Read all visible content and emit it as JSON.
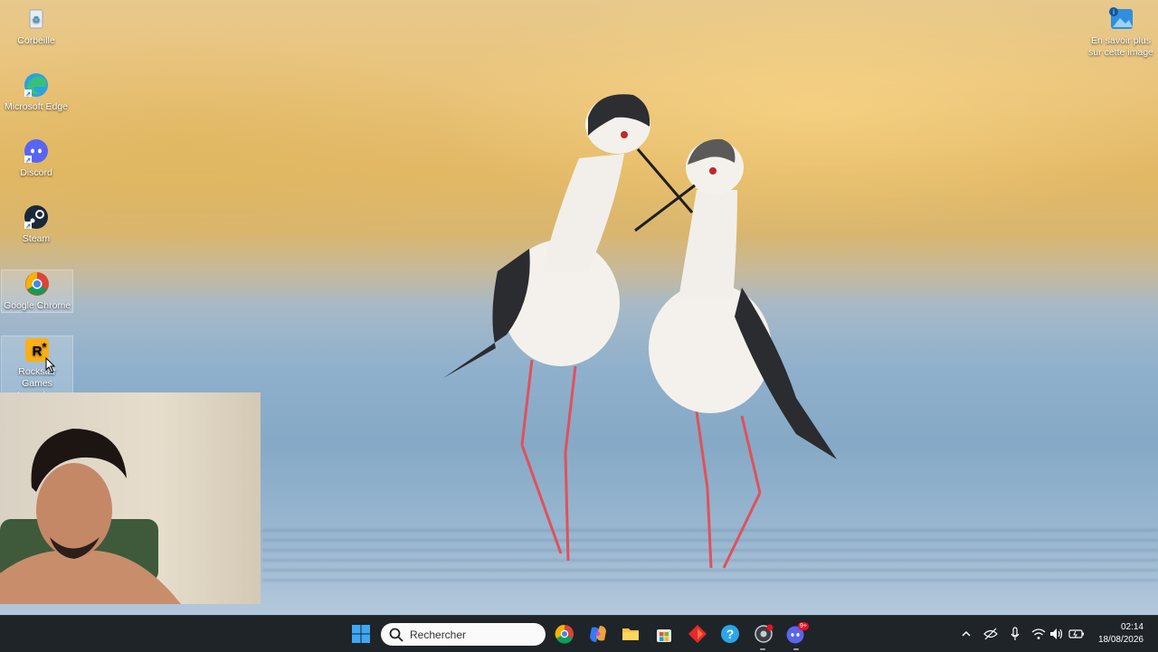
{
  "desktop": {
    "icons": [
      {
        "label": "Corbeille",
        "icon": "recycle-bin-icon"
      },
      {
        "label": "Microsoft Edge",
        "icon": "edge-icon"
      },
      {
        "label": "Discord",
        "icon": "discord-icon"
      },
      {
        "label": "Steam",
        "icon": "steam-icon"
      },
      {
        "label": "Google Chrome",
        "icon": "chrome-icon"
      },
      {
        "label": "Rockstar Games Launcher",
        "icon": "rockstar-icon"
      }
    ],
    "spotlight": {
      "label": "En savoir plus sur cette image",
      "icon": "spotlight-info-icon"
    }
  },
  "taskbar": {
    "search_placeholder": "Rechercher",
    "pinned": [
      {
        "name": "Google Chrome",
        "icon": "chrome-icon"
      },
      {
        "name": "Copilot",
        "icon": "copilot-icon"
      },
      {
        "name": "File Explorer",
        "icon": "folder-icon"
      },
      {
        "name": "Microsoft Store",
        "icon": "store-icon"
      },
      {
        "name": "Rockstar / App",
        "icon": "red-diamond-icon"
      },
      {
        "name": "Help",
        "icon": "help-icon"
      },
      {
        "name": "Recording App",
        "icon": "record-icon"
      },
      {
        "name": "Discord",
        "icon": "discord-icon"
      }
    ],
    "discord_badge": "9+",
    "clock": {
      "time": "02:14",
      "date": "18/08/2026"
    }
  },
  "colors": {
    "taskbar_bg": "#1f2428",
    "accent": "#0078d4",
    "discord": "#5865f2"
  }
}
